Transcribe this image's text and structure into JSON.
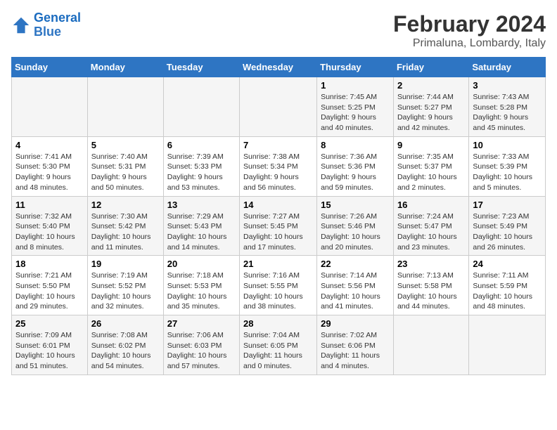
{
  "logo": {
    "text_general": "General",
    "text_blue": "Blue"
  },
  "header": {
    "title": "February 2024",
    "subtitle": "Primaluna, Lombardy, Italy"
  },
  "days_of_week": [
    "Sunday",
    "Monday",
    "Tuesday",
    "Wednesday",
    "Thursday",
    "Friday",
    "Saturday"
  ],
  "weeks": [
    [
      {
        "day": "",
        "info": ""
      },
      {
        "day": "",
        "info": ""
      },
      {
        "day": "",
        "info": ""
      },
      {
        "day": "",
        "info": ""
      },
      {
        "day": "1",
        "info": "Sunrise: 7:45 AM\nSunset: 5:25 PM\nDaylight: 9 hours and 40 minutes."
      },
      {
        "day": "2",
        "info": "Sunrise: 7:44 AM\nSunset: 5:27 PM\nDaylight: 9 hours and 42 minutes."
      },
      {
        "day": "3",
        "info": "Sunrise: 7:43 AM\nSunset: 5:28 PM\nDaylight: 9 hours and 45 minutes."
      }
    ],
    [
      {
        "day": "4",
        "info": "Sunrise: 7:41 AM\nSunset: 5:30 PM\nDaylight: 9 hours and 48 minutes."
      },
      {
        "day": "5",
        "info": "Sunrise: 7:40 AM\nSunset: 5:31 PM\nDaylight: 9 hours and 50 minutes."
      },
      {
        "day": "6",
        "info": "Sunrise: 7:39 AM\nSunset: 5:33 PM\nDaylight: 9 hours and 53 minutes."
      },
      {
        "day": "7",
        "info": "Sunrise: 7:38 AM\nSunset: 5:34 PM\nDaylight: 9 hours and 56 minutes."
      },
      {
        "day": "8",
        "info": "Sunrise: 7:36 AM\nSunset: 5:36 PM\nDaylight: 9 hours and 59 minutes."
      },
      {
        "day": "9",
        "info": "Sunrise: 7:35 AM\nSunset: 5:37 PM\nDaylight: 10 hours and 2 minutes."
      },
      {
        "day": "10",
        "info": "Sunrise: 7:33 AM\nSunset: 5:39 PM\nDaylight: 10 hours and 5 minutes."
      }
    ],
    [
      {
        "day": "11",
        "info": "Sunrise: 7:32 AM\nSunset: 5:40 PM\nDaylight: 10 hours and 8 minutes."
      },
      {
        "day": "12",
        "info": "Sunrise: 7:30 AM\nSunset: 5:42 PM\nDaylight: 10 hours and 11 minutes."
      },
      {
        "day": "13",
        "info": "Sunrise: 7:29 AM\nSunset: 5:43 PM\nDaylight: 10 hours and 14 minutes."
      },
      {
        "day": "14",
        "info": "Sunrise: 7:27 AM\nSunset: 5:45 PM\nDaylight: 10 hours and 17 minutes."
      },
      {
        "day": "15",
        "info": "Sunrise: 7:26 AM\nSunset: 5:46 PM\nDaylight: 10 hours and 20 minutes."
      },
      {
        "day": "16",
        "info": "Sunrise: 7:24 AM\nSunset: 5:47 PM\nDaylight: 10 hours and 23 minutes."
      },
      {
        "day": "17",
        "info": "Sunrise: 7:23 AM\nSunset: 5:49 PM\nDaylight: 10 hours and 26 minutes."
      }
    ],
    [
      {
        "day": "18",
        "info": "Sunrise: 7:21 AM\nSunset: 5:50 PM\nDaylight: 10 hours and 29 minutes."
      },
      {
        "day": "19",
        "info": "Sunrise: 7:19 AM\nSunset: 5:52 PM\nDaylight: 10 hours and 32 minutes."
      },
      {
        "day": "20",
        "info": "Sunrise: 7:18 AM\nSunset: 5:53 PM\nDaylight: 10 hours and 35 minutes."
      },
      {
        "day": "21",
        "info": "Sunrise: 7:16 AM\nSunset: 5:55 PM\nDaylight: 10 hours and 38 minutes."
      },
      {
        "day": "22",
        "info": "Sunrise: 7:14 AM\nSunset: 5:56 PM\nDaylight: 10 hours and 41 minutes."
      },
      {
        "day": "23",
        "info": "Sunrise: 7:13 AM\nSunset: 5:58 PM\nDaylight: 10 hours and 44 minutes."
      },
      {
        "day": "24",
        "info": "Sunrise: 7:11 AM\nSunset: 5:59 PM\nDaylight: 10 hours and 48 minutes."
      }
    ],
    [
      {
        "day": "25",
        "info": "Sunrise: 7:09 AM\nSunset: 6:01 PM\nDaylight: 10 hours and 51 minutes."
      },
      {
        "day": "26",
        "info": "Sunrise: 7:08 AM\nSunset: 6:02 PM\nDaylight: 10 hours and 54 minutes."
      },
      {
        "day": "27",
        "info": "Sunrise: 7:06 AM\nSunset: 6:03 PM\nDaylight: 10 hours and 57 minutes."
      },
      {
        "day": "28",
        "info": "Sunrise: 7:04 AM\nSunset: 6:05 PM\nDaylight: 11 hours and 0 minutes."
      },
      {
        "day": "29",
        "info": "Sunrise: 7:02 AM\nSunset: 6:06 PM\nDaylight: 11 hours and 4 minutes."
      },
      {
        "day": "",
        "info": ""
      },
      {
        "day": "",
        "info": ""
      }
    ]
  ]
}
